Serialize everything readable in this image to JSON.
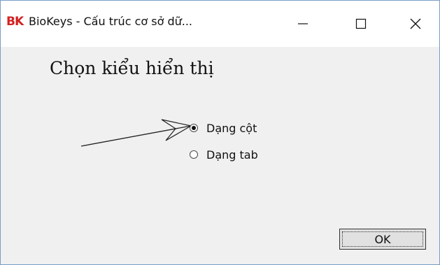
{
  "window": {
    "icon_text": "BK",
    "title": "BioKeys - Cấu trúc cơ sở dữ...",
    "minimize_glyph": "—",
    "maximize_glyph": "☐",
    "close_glyph": "✕"
  },
  "dialog": {
    "heading": "Chọn kiểu hiển thị",
    "options": [
      {
        "label": "Dạng cột",
        "selected": true
      },
      {
        "label": "Dạng tab",
        "selected": false
      }
    ],
    "ok_label": "OK"
  },
  "colors": {
    "app_icon": "#d42020",
    "window_border": "#7a9cc6",
    "client_background": "#f0f0f0"
  }
}
